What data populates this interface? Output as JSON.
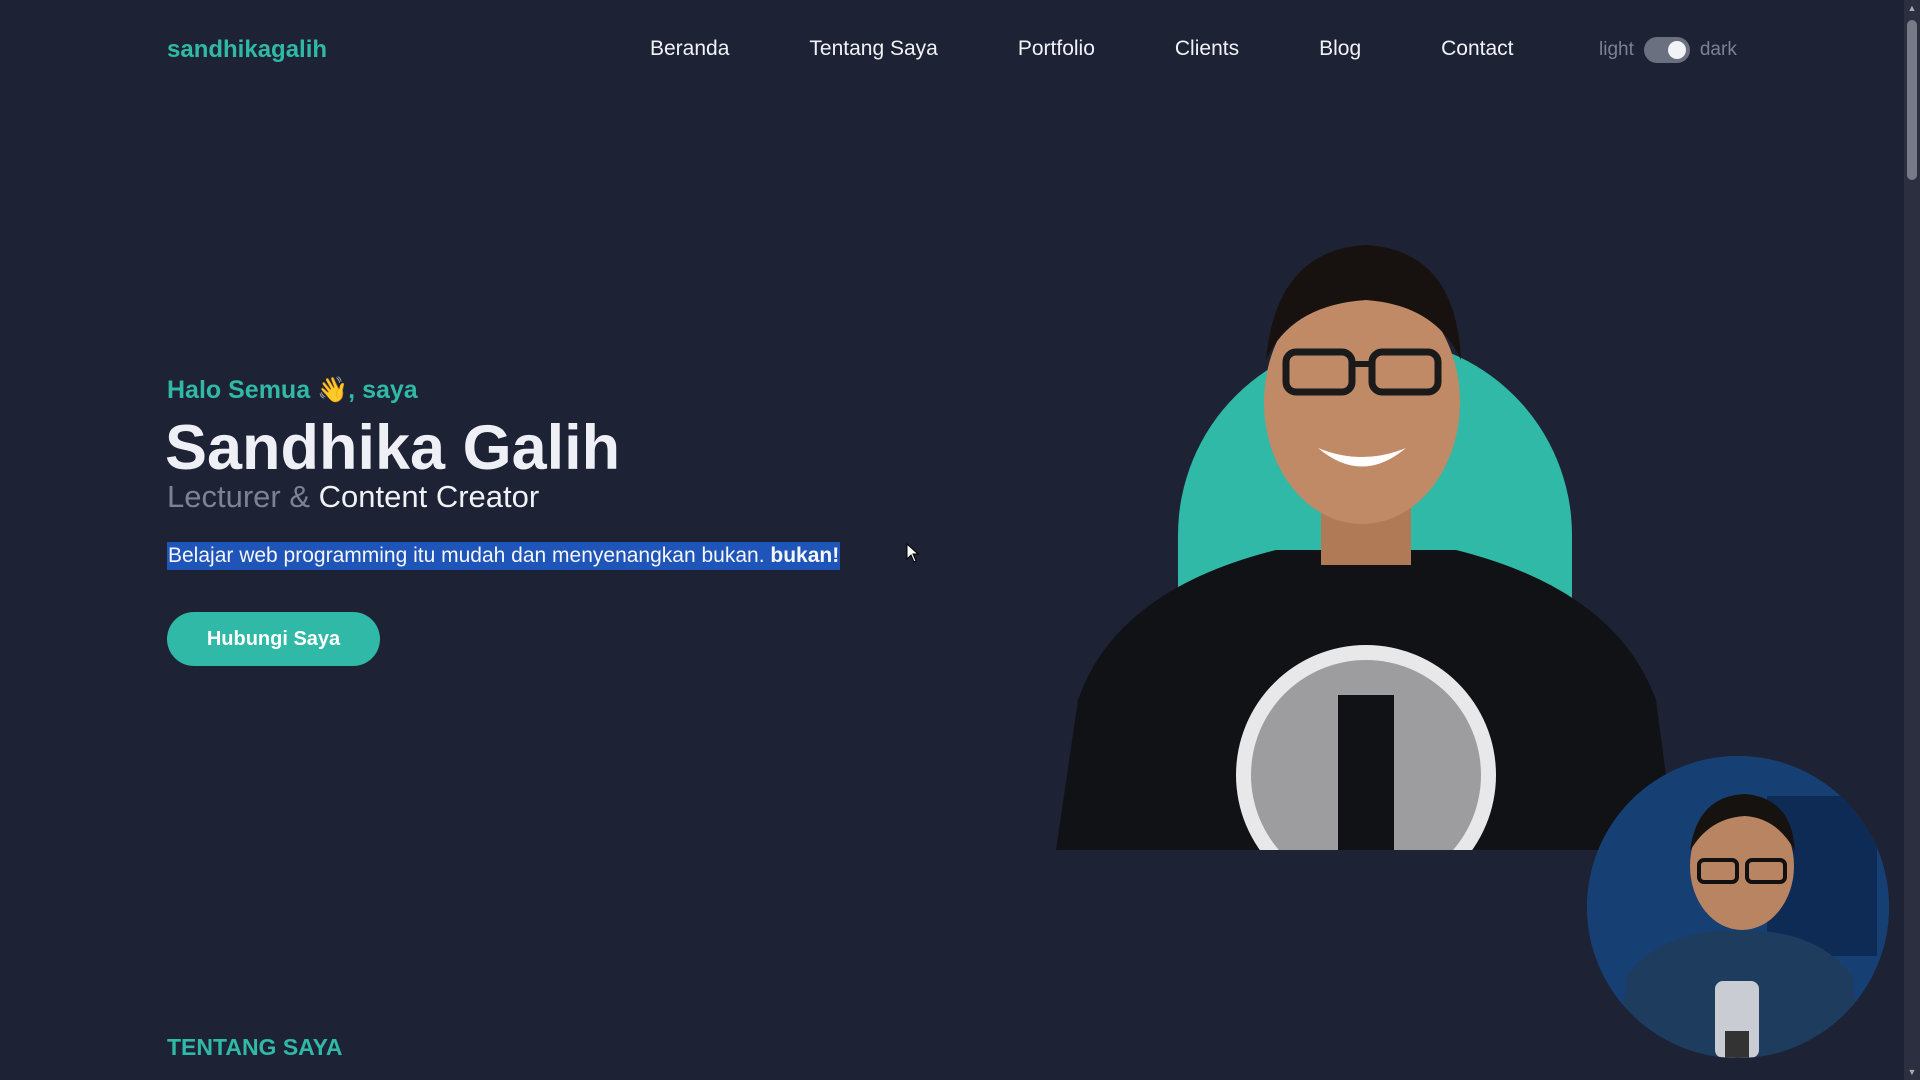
{
  "header": {
    "brand": "sandhikagalih",
    "nav": [
      "Beranda",
      "Tentang Saya",
      "Portfolio",
      "Clients",
      "Blog",
      "Contact"
    ],
    "theme_light": "light",
    "theme_dark": "dark",
    "theme_mode": "dark"
  },
  "hero": {
    "greeting": "Halo Semua 👋, saya",
    "name": "Sandhika Galih",
    "role_prefix": "Lecturer &",
    "role_main": "Content Creator",
    "description": "Belajar web programming itu mudah dan menyenangkan bukan.",
    "description_bold": "bukan!",
    "cta_label": "Hubungi Saya"
  },
  "about": {
    "section_title": "TENTANG SAYA"
  },
  "colors": {
    "background": "#1e2235",
    "accent": "#2fb9a6",
    "selection": "#1f54b8"
  },
  "icons": [
    "waving-hand-icon",
    "mouse-cursor-icon",
    "toggle-switch-icon"
  ]
}
